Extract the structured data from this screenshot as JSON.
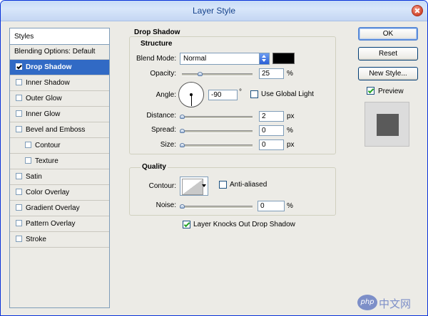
{
  "window": {
    "title": "Layer Style"
  },
  "styles_panel": {
    "header": "Styles",
    "items": [
      {
        "label": "Blending Options: Default",
        "has_checkbox": false,
        "checked": false,
        "selected": false
      },
      {
        "label": "Drop Shadow",
        "has_checkbox": true,
        "checked": true,
        "selected": true
      },
      {
        "label": "Inner Shadow",
        "has_checkbox": true,
        "checked": false,
        "selected": false
      },
      {
        "label": "Outer Glow",
        "has_checkbox": true,
        "checked": false,
        "selected": false
      },
      {
        "label": "Inner Glow",
        "has_checkbox": true,
        "checked": false,
        "selected": false
      },
      {
        "label": "Bevel and Emboss",
        "has_checkbox": true,
        "checked": false,
        "selected": false
      },
      {
        "label": "Contour",
        "has_checkbox": true,
        "checked": false,
        "selected": false,
        "indent": true
      },
      {
        "label": "Texture",
        "has_checkbox": true,
        "checked": false,
        "selected": false,
        "indent": true
      },
      {
        "label": "Satin",
        "has_checkbox": true,
        "checked": false,
        "selected": false
      },
      {
        "label": "Color Overlay",
        "has_checkbox": true,
        "checked": false,
        "selected": false
      },
      {
        "label": "Gradient Overlay",
        "has_checkbox": true,
        "checked": false,
        "selected": false
      },
      {
        "label": "Pattern Overlay",
        "has_checkbox": true,
        "checked": false,
        "selected": false
      },
      {
        "label": "Stroke",
        "has_checkbox": true,
        "checked": false,
        "selected": false
      }
    ]
  },
  "drop_shadow": {
    "title": "Drop Shadow",
    "structure": {
      "title": "Structure",
      "blend_mode_label": "Blend Mode:",
      "blend_mode_value": "Normal",
      "shadow_color": "#000000",
      "opacity_label": "Opacity:",
      "opacity_value": "25",
      "opacity_unit": "%",
      "opacity_fraction": 0.25,
      "angle_label": "Angle:",
      "angle_value": "-90",
      "angle_unit": "°",
      "use_global_light_label": "Use Global Light",
      "use_global_light_checked": false,
      "distance_label": "Distance:",
      "distance_value": "2",
      "distance_unit": "px",
      "spread_label": "Spread:",
      "spread_value": "0",
      "spread_unit": "%",
      "size_label": "Size:",
      "size_value": "0",
      "size_unit": "px"
    },
    "quality": {
      "title": "Quality",
      "contour_label": "Contour:",
      "anti_aliased_label": "Anti-aliased",
      "anti_aliased_checked": false,
      "noise_label": "Noise:",
      "noise_value": "0",
      "noise_unit": "%"
    },
    "knockout_label": "Layer Knocks Out Drop Shadow",
    "knockout_checked": true
  },
  "buttons": {
    "ok": "OK",
    "reset": "Reset",
    "new_style": "New Style...",
    "preview_label": "Preview",
    "preview_checked": true
  },
  "watermark": {
    "logo": "php",
    "text": "中文网"
  }
}
